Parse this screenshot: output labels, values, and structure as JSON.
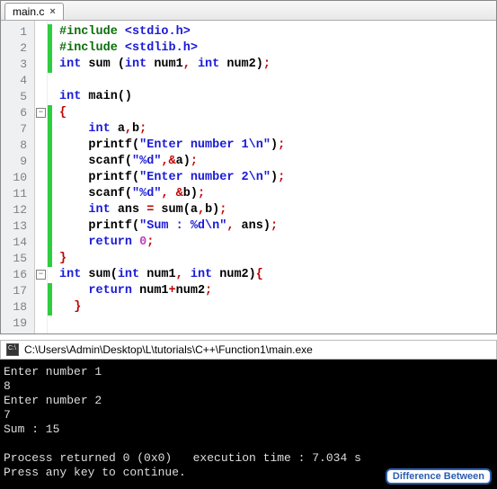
{
  "tab": {
    "name": "main.c"
  },
  "lines": [
    {
      "n": 1,
      "tokens": [
        [
          "kw",
          "#include "
        ],
        [
          "str",
          "<stdio.h>"
        ]
      ]
    },
    {
      "n": 2,
      "tokens": [
        [
          "kw",
          "#include "
        ],
        [
          "str",
          "<stdlib.h>"
        ]
      ]
    },
    {
      "n": 3,
      "tokens": [
        [
          "type",
          "int "
        ],
        [
          "ident",
          "sum "
        ],
        [
          "punc",
          "("
        ],
        [
          "type",
          "int "
        ],
        [
          "ident",
          "num1"
        ],
        [
          "op",
          ", "
        ],
        [
          "type",
          "int "
        ],
        [
          "ident",
          "num2"
        ],
        [
          "punc",
          ")"
        ],
        [
          "op",
          ";"
        ]
      ]
    },
    {
      "n": 4,
      "tokens": []
    },
    {
      "n": 5,
      "tokens": [
        [
          "type",
          "int "
        ],
        [
          "ident",
          "main"
        ],
        [
          "punc",
          "()"
        ]
      ]
    },
    {
      "n": 6,
      "tokens": [
        [
          "op",
          "{"
        ]
      ]
    },
    {
      "n": 7,
      "tokens": [
        [
          "ident",
          "    "
        ],
        [
          "type",
          "int "
        ],
        [
          "ident",
          "a"
        ],
        [
          "op",
          ","
        ],
        [
          "ident",
          "b"
        ],
        [
          "op",
          ";"
        ]
      ]
    },
    {
      "n": 8,
      "tokens": [
        [
          "ident",
          "    printf"
        ],
        [
          "punc",
          "("
        ],
        [
          "str",
          "\"Enter number 1\\n\""
        ],
        [
          "punc",
          ")"
        ],
        [
          "op",
          ";"
        ]
      ]
    },
    {
      "n": 9,
      "tokens": [
        [
          "ident",
          "    scanf"
        ],
        [
          "punc",
          "("
        ],
        [
          "str",
          "\"%d\""
        ],
        [
          "op",
          ",&"
        ],
        [
          "ident",
          "a"
        ],
        [
          "punc",
          ")"
        ],
        [
          "op",
          ";"
        ]
      ]
    },
    {
      "n": 10,
      "tokens": [
        [
          "ident",
          "    printf"
        ],
        [
          "punc",
          "("
        ],
        [
          "str",
          "\"Enter number 2\\n\""
        ],
        [
          "punc",
          ")"
        ],
        [
          "op",
          ";"
        ]
      ]
    },
    {
      "n": 11,
      "tokens": [
        [
          "ident",
          "    scanf"
        ],
        [
          "punc",
          "("
        ],
        [
          "str",
          "\"%d\""
        ],
        [
          "op",
          ", &"
        ],
        [
          "ident",
          "b"
        ],
        [
          "punc",
          ")"
        ],
        [
          "op",
          ";"
        ]
      ]
    },
    {
      "n": 12,
      "tokens": [
        [
          "ident",
          "    "
        ],
        [
          "type",
          "int "
        ],
        [
          "ident",
          "ans "
        ],
        [
          "op",
          "= "
        ],
        [
          "ident",
          "sum"
        ],
        [
          "punc",
          "("
        ],
        [
          "ident",
          "a"
        ],
        [
          "op",
          ","
        ],
        [
          "ident",
          "b"
        ],
        [
          "punc",
          ")"
        ],
        [
          "op",
          ";"
        ]
      ]
    },
    {
      "n": 13,
      "tokens": [
        [
          "ident",
          "    printf"
        ],
        [
          "punc",
          "("
        ],
        [
          "str",
          "\"Sum : %d\\n\""
        ],
        [
          "op",
          ", "
        ],
        [
          "ident",
          "ans"
        ],
        [
          "punc",
          ")"
        ],
        [
          "op",
          ";"
        ]
      ]
    },
    {
      "n": 14,
      "tokens": [
        [
          "ident",
          "    "
        ],
        [
          "type",
          "return "
        ],
        [
          "num",
          "0"
        ],
        [
          "op",
          ";"
        ]
      ]
    },
    {
      "n": 15,
      "tokens": [
        [
          "op",
          "}"
        ]
      ]
    },
    {
      "n": 16,
      "tokens": [
        [
          "type",
          "int "
        ],
        [
          "ident",
          "sum"
        ],
        [
          "punc",
          "("
        ],
        [
          "type",
          "int "
        ],
        [
          "ident",
          "num1"
        ],
        [
          "op",
          ", "
        ],
        [
          "type",
          "int "
        ],
        [
          "ident",
          "num2"
        ],
        [
          "punc",
          ")"
        ],
        [
          "op",
          "{"
        ]
      ]
    },
    {
      "n": 17,
      "tokens": [
        [
          "ident",
          "    "
        ],
        [
          "type",
          "return "
        ],
        [
          "ident",
          "num1"
        ],
        [
          "op",
          "+"
        ],
        [
          "ident",
          "num2"
        ],
        [
          "op",
          ";"
        ]
      ]
    },
    {
      "n": 18,
      "tokens": [
        [
          "ident",
          "  "
        ],
        [
          "op",
          "}"
        ]
      ]
    },
    {
      "n": 19,
      "tokens": []
    }
  ],
  "change_bars": [
    {
      "from": 1,
      "to": 3
    },
    {
      "from": 6,
      "to": 15
    },
    {
      "from": 17,
      "to": 18
    }
  ],
  "fold_marks": [
    {
      "line": 6
    },
    {
      "line": 16
    }
  ],
  "console": {
    "title": "C:\\Users\\Admin\\Desktop\\L\\tutorials\\C++\\Function1\\main.exe",
    "lines": [
      "Enter number 1",
      "8",
      "Enter number 2",
      "7",
      "Sum : 15",
      "",
      "Process returned 0 (0x0)   execution time : 7.034 s",
      "Press any key to continue."
    ]
  },
  "watermark": "Difference Between"
}
